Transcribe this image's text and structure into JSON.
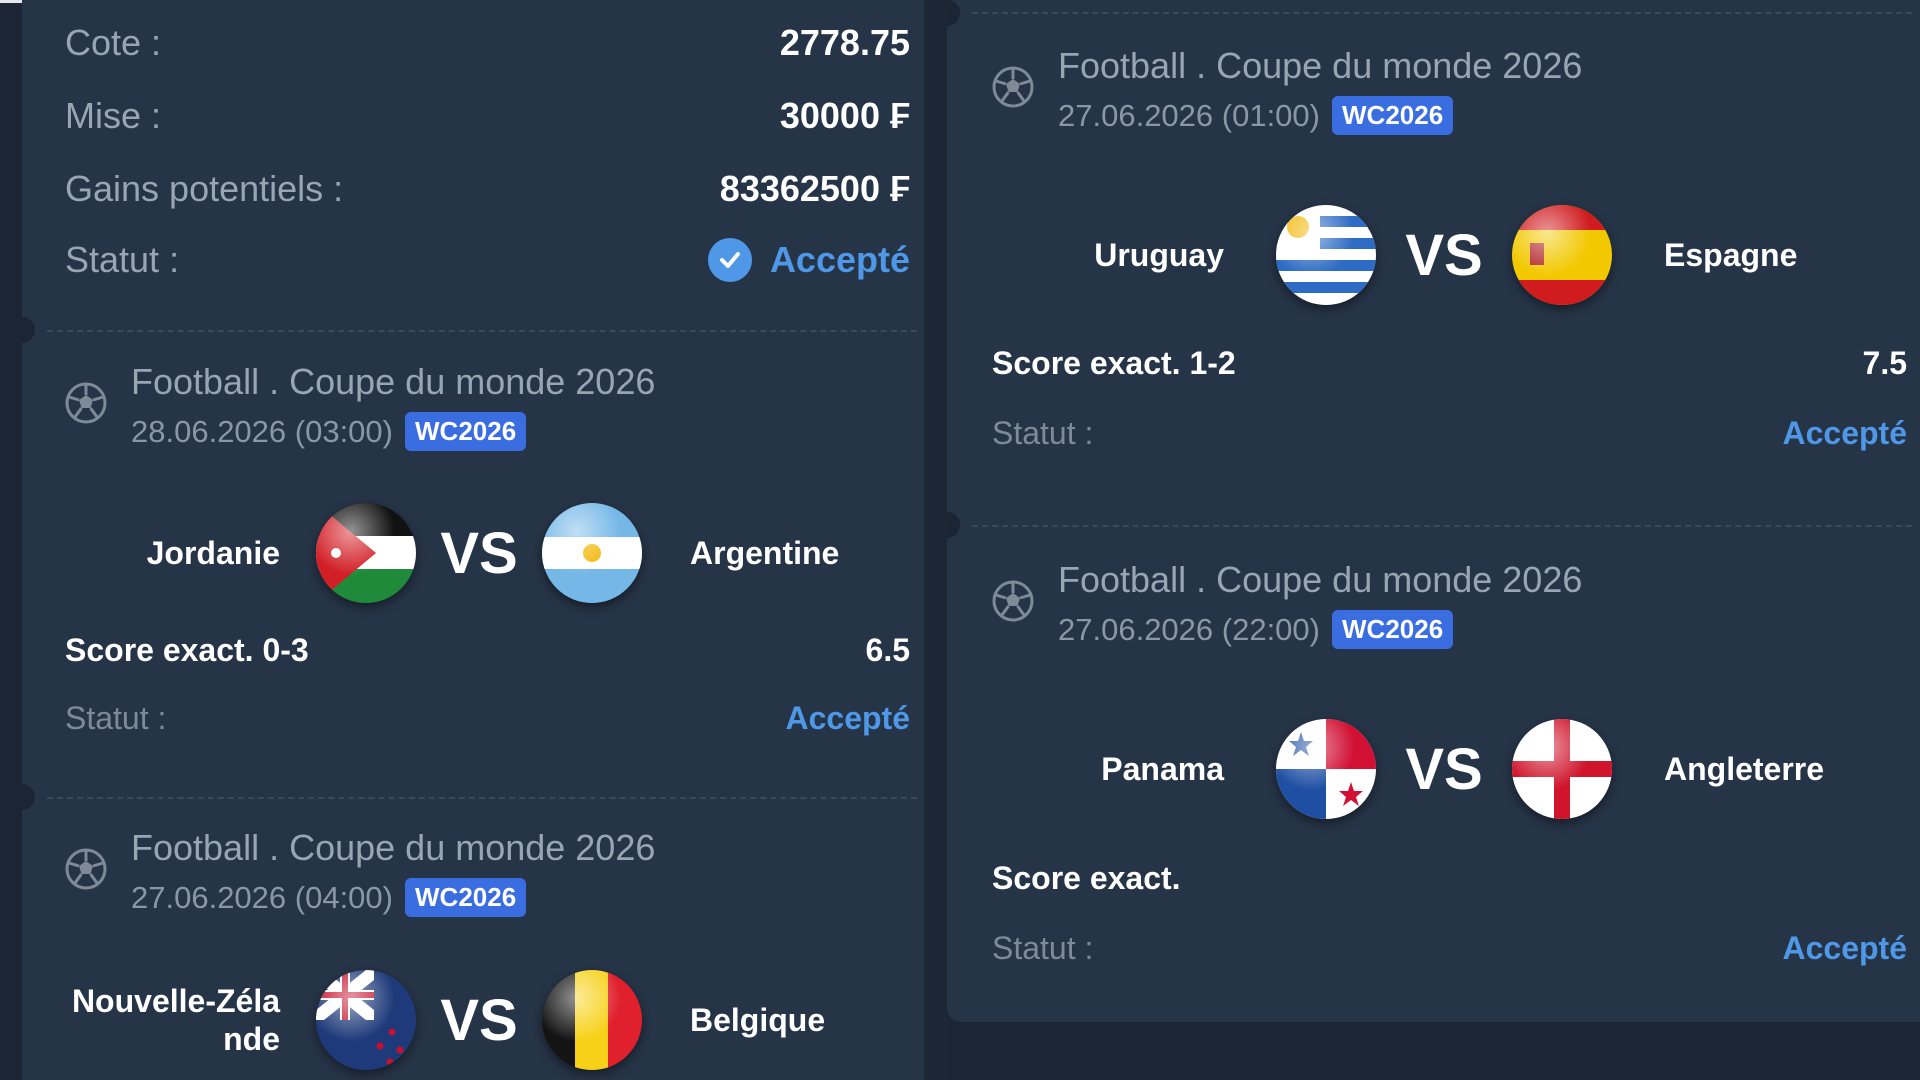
{
  "summary": {
    "cote_label": "Cote :",
    "cote_value": "2778.75",
    "mise_label": "Mise :",
    "mise_value": "30000 ₣",
    "gains_label": "Gains potentiels :",
    "gains_value": "83362500 ₣",
    "statut_label": "Statut :",
    "statut_value": "Accepté"
  },
  "events": [
    {
      "league": "Football . Coupe du monde 2026",
      "date": "28.06.2026 (03:00)",
      "badge": "WC2026",
      "home": "Jordanie",
      "away": "Argentine",
      "vs": "VS",
      "bet": "Score exact. 0-3",
      "odd": "6.5",
      "status_label": "Statut :",
      "status": "Accepté"
    },
    {
      "league": "Football . Coupe du monde 2026",
      "date": "27.06.2026 (04:00)",
      "badge": "WC2026",
      "home_line1": "Nouvelle-Zéla",
      "home_line2": "nde",
      "away": "Belgique",
      "vs": "VS"
    },
    {
      "league": "Football . Coupe du monde 2026",
      "date": "27.06.2026 (01:00)",
      "badge": "WC2026",
      "home": "Uruguay",
      "away": "Espagne",
      "vs": "VS",
      "bet": "Score exact. 1-2",
      "odd": "7.5",
      "status_label": "Statut :",
      "status": "Accepté"
    },
    {
      "league": "Football . Coupe du monde 2026",
      "date": "27.06.2026 (22:00)",
      "badge": "WC2026",
      "home": "Panama",
      "away": "Angleterre",
      "vs": "VS",
      "bet": "Score exact.",
      "status_label": "Statut :",
      "status": "Accepté"
    }
  ],
  "icons": {
    "sport": "soccer-ball-icon",
    "status": "check-circle-icon",
    "flags": [
      "jordan-flag-icon",
      "argentina-flag-icon",
      "new-zealand-flag-icon",
      "belgium-flag-icon",
      "uruguay-flag-icon",
      "spain-flag-icon",
      "panama-flag-icon",
      "england-flag-icon"
    ]
  },
  "colors": {
    "panel": "#263447",
    "background": "#1b2533",
    "accent": "#4f98e8",
    "badge": "#3a6ee0"
  }
}
